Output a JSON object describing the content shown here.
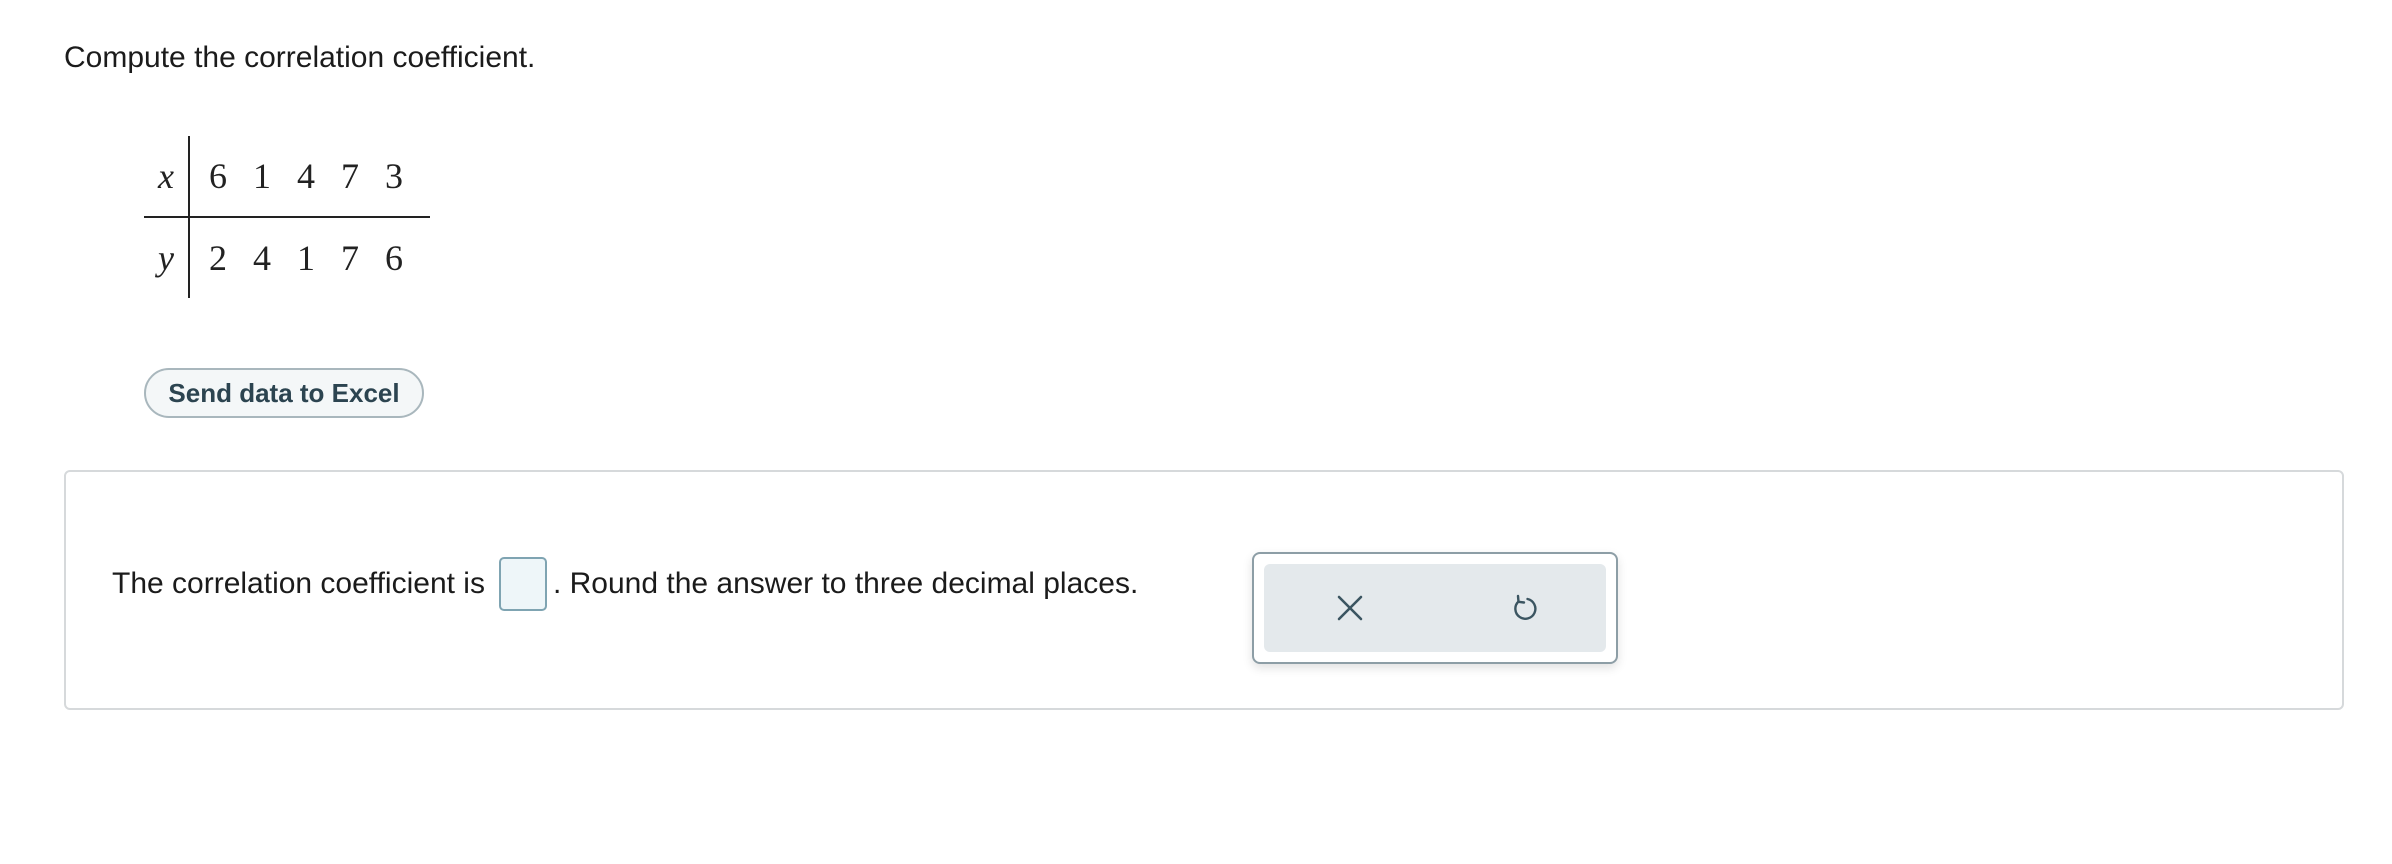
{
  "question": {
    "prompt": "Compute the correlation coefficient."
  },
  "data_table": {
    "rows": [
      {
        "label": "x",
        "values": [
          "6",
          "1",
          "4",
          "7",
          "3"
        ]
      },
      {
        "label": "y",
        "values": [
          "2",
          "4",
          "1",
          "7",
          "6"
        ]
      }
    ]
  },
  "excel_button": {
    "label": "Send data to Excel"
  },
  "answer": {
    "prefix": "The correlation coefficient is",
    "input_value": "",
    "suffix": ". Round the answer to three decimal places."
  },
  "tools": {
    "clear_icon": "close-icon",
    "undo_icon": "undo-icon"
  },
  "colors": {
    "input_border": "#7fa4b2",
    "input_fill": "#eef6f9",
    "button_text": "#2c4450",
    "tool_fill": "#e4e9ec"
  }
}
